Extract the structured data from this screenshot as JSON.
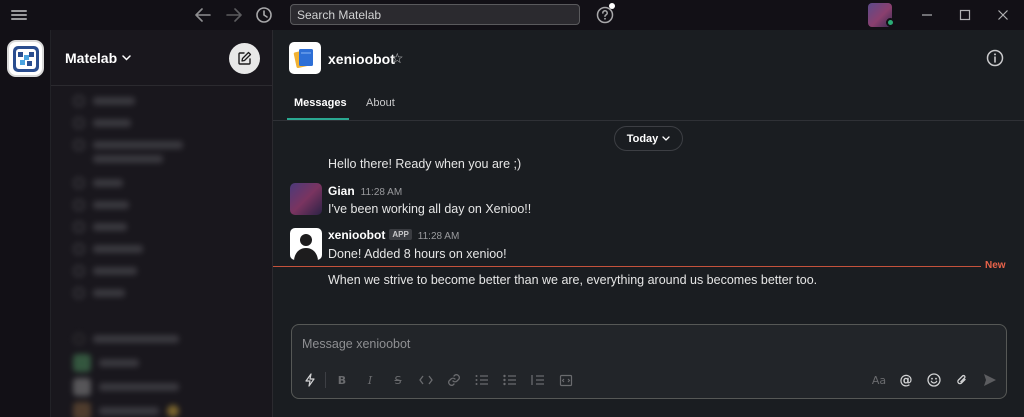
{
  "titlebar": {
    "search_placeholder": "Search Matelab"
  },
  "sidebar": {
    "workspace_name": "Matelab"
  },
  "channel": {
    "title": "xenioobot",
    "tabs": [
      {
        "label": "Messages",
        "active": true
      },
      {
        "label": "About",
        "active": false
      }
    ],
    "date_divider": "Today"
  },
  "messages": [
    {
      "text": "Hello there! Ready when you are ;)"
    },
    {
      "author": "Gian",
      "time": "11:28 AM",
      "text": "I've been working all day on Xenioo!!"
    },
    {
      "author": "xenioobot",
      "badge": "APP",
      "time": "11:28 AM",
      "text": "Done! Added 8 hours on xenioo!"
    },
    {
      "text": "When we strive to become better than we are, everything around us becomes better too."
    }
  ],
  "new_marker": "New",
  "composer": {
    "placeholder": "Message xenioobot",
    "format_label": "Aa"
  },
  "colors": {
    "accent": "#2aa891",
    "new_marker": "#e8634a",
    "online": "#2bac76"
  }
}
